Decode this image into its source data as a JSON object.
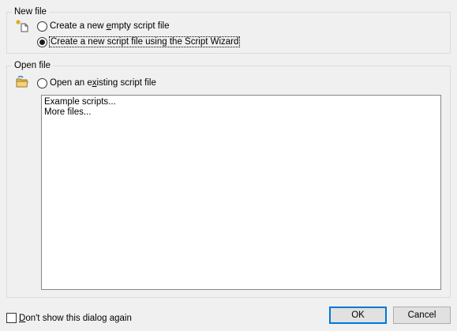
{
  "new_file": {
    "group_title": "New file",
    "option_empty_pre": "Create a new ",
    "option_empty_ul": "e",
    "option_empty_post": "mpty script file",
    "option_wizard": "Create a new script file using the Script Wizard",
    "selected": "wizard"
  },
  "open_file": {
    "group_title": "Open file",
    "option_existing_pre": "Open an e",
    "option_existing_ul": "x",
    "option_existing_post": "isting script file",
    "list_items": [
      "Example scripts...",
      "More files..."
    ]
  },
  "footer": {
    "dont_show_ul": "D",
    "dont_show_post": "on't show this dialog again",
    "ok_label": "OK",
    "cancel_label": "Cancel"
  },
  "icons": {
    "new_file": "new-file-icon",
    "open_folder": "open-folder-icon"
  }
}
